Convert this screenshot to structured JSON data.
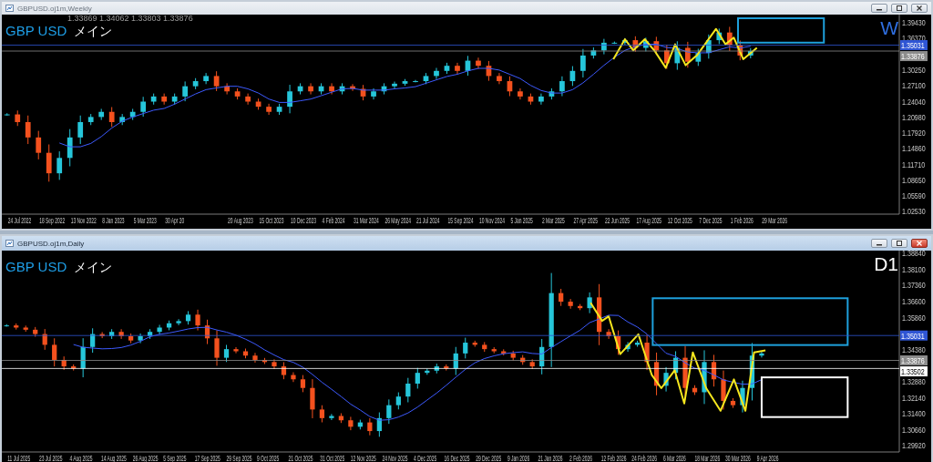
{
  "windows": [
    {
      "title": "GBPUSD.oj1m,Weekly",
      "active": false,
      "header": {
        "symbol_label": "GBP USD",
        "caption": "メイン",
        "ohlc": "1.33869 1.34062 1.33803 1.33876"
      },
      "timeframe_label": "W",
      "price_labels": [
        "1.39430",
        "1.36370",
        "1.30250",
        "1.27100",
        "1.24040",
        "1.20980",
        "1.17920",
        "1.14860",
        "1.11710",
        "1.08650",
        "1.05590",
        "1.02530"
      ],
      "price_tags": [
        {
          "text": "1.35031",
          "color": "#2f55d4"
        },
        {
          "text": "1.33876",
          "color": "#8c8c8c"
        }
      ],
      "date_labels": [
        "24 Jul 2022",
        "18 Sep 2022",
        "13 Nov 2022",
        "8 Jan 2023",
        "5 Mar 2023",
        "30 Apr 20",
        "20 Aug 2023",
        "15 Oct 2023",
        "10 Dec 2023",
        "4 Feb 2024",
        "31 Mar 2024",
        "26 May 2024",
        "21 Jul 2024",
        "15 Sep 2024",
        "10 Nov 2024",
        "5 Jan 2025",
        "2 Mar 2025",
        "27 Apr 2025",
        "22 Jun 2025",
        "17 Aug 2025",
        "12 Oct 2025",
        "7 Dec 2025",
        "1 Feb 2026",
        "29 Mar 2026"
      ]
    },
    {
      "title": "GBPUSD.oj1m,Daily",
      "active": true,
      "header": {
        "symbol_label": "GBP USD",
        "caption": "メイン"
      },
      "timeframe_label": "D1",
      "price_labels": [
        "1.38840",
        "1.38100",
        "1.37360",
        "1.36600",
        "1.35860",
        "1.34380",
        "1.32880",
        "1.32140",
        "1.31400",
        "1.30660",
        "1.29920"
      ],
      "price_tags": [
        {
          "text": "1.35031",
          "color": "#2f55d4"
        },
        {
          "text": "1.33876",
          "color": "#8c8c8c"
        },
        {
          "text": "1.33502",
          "color": "#ffffff"
        }
      ],
      "date_labels": [
        "11 Jul 2025",
        "23 Jul 2025",
        "4 Aug 2025",
        "14 Aug 2025",
        "26 Aug 2025",
        "5 Sep 2025",
        "17 Sep 2025",
        "29 Sep 2025",
        "9 Oct 2025",
        "21 Oct 2025",
        "31 Oct 2025",
        "12 Nov 2025",
        "24 Nov 2025",
        "4 Dec 2025",
        "16 Dec 2025",
        "29 Dec 2025",
        "9 Jan 2026",
        "21 Jan 2026",
        "2 Feb 2026",
        "12 Feb 2026",
        "24 Feb 2026",
        "6 Mar 2026",
        "18 Mar 2026",
        "30 Mar 2026",
        "9 Apr 2026"
      ]
    }
  ]
}
